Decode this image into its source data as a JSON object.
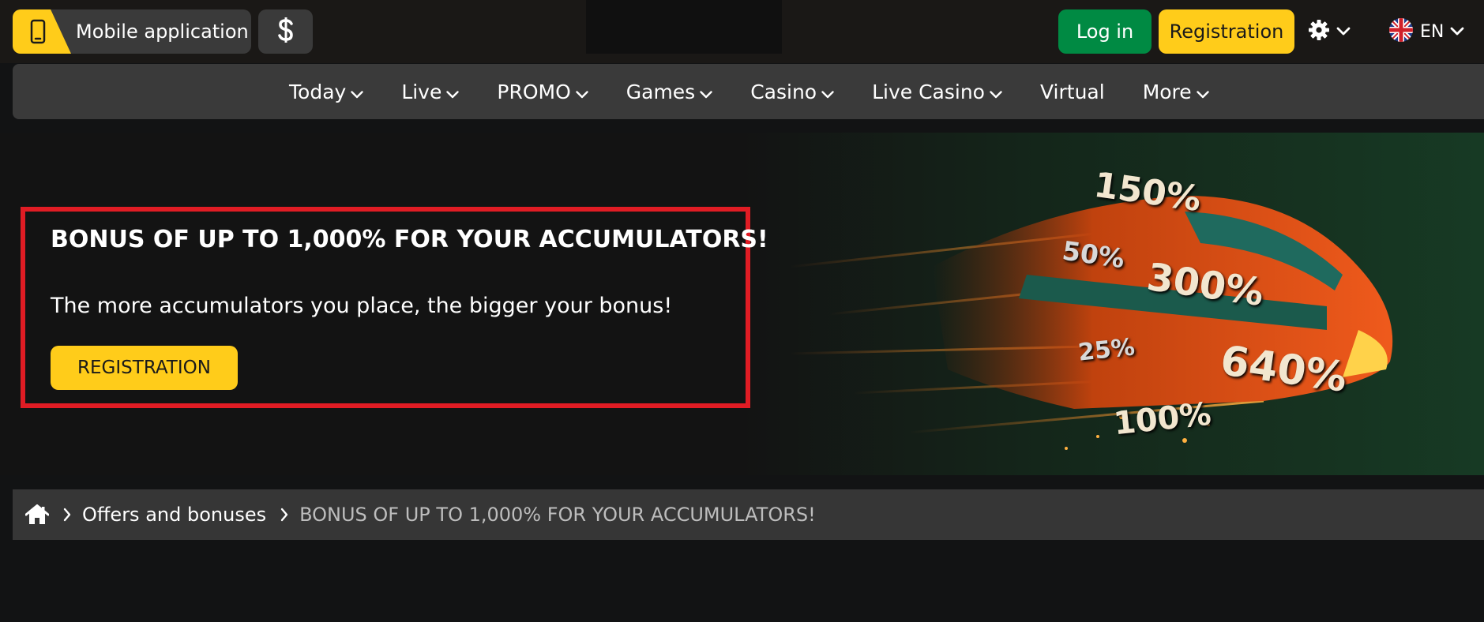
{
  "header": {
    "mobile_app_label": "Mobile application",
    "login_label": "Log in",
    "registration_label": "Registration",
    "language_code": "EN",
    "icons": [
      "smartphone-icon",
      "dollar-icon",
      "gear-icon",
      "chevron-down-icon",
      "uk-flag-icon"
    ]
  },
  "nav": {
    "items": [
      {
        "label": "Today",
        "dropdown": true
      },
      {
        "label": "Live",
        "dropdown": true
      },
      {
        "label": "PROMO",
        "dropdown": true
      },
      {
        "label": "Games",
        "dropdown": true
      },
      {
        "label": "Casino",
        "dropdown": true
      },
      {
        "label": "Live Casino",
        "dropdown": true
      },
      {
        "label": "Virtual",
        "dropdown": false
      },
      {
        "label": "More",
        "dropdown": true
      }
    ]
  },
  "banner": {
    "title": "BONUS OF UP TO 1,000% FOR YOUR ACCUMULATORS!",
    "text": "The more accumulators you place, the bigger your bonus!",
    "button_label": "REGISTRATION",
    "percent_labels": [
      "150%",
      "50%",
      "300%",
      "25%",
      "640%",
      "100%"
    ]
  },
  "breadcrumb": {
    "home_icon": "home-icon",
    "items": [
      "Offers and bonuses"
    ],
    "current": "BONUS OF UP TO 1,000% FOR YOUR ACCUMULATORS!"
  },
  "colors": {
    "accent_yellow": "#ffcc1a",
    "login_green": "#008a43",
    "highlight_red": "#e01c24",
    "panel_gray": "#3a3a3a",
    "background": "#121314"
  }
}
